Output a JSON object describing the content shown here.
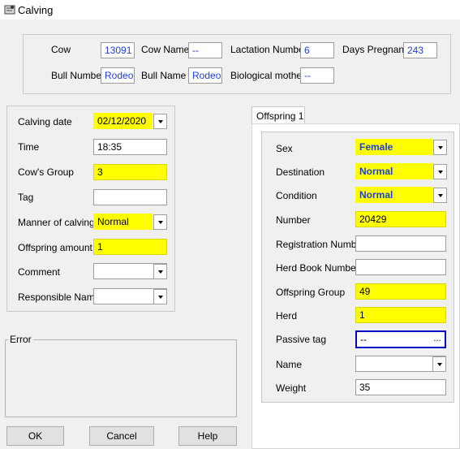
{
  "window": {
    "title": "Calving",
    "icon": "calving-app-icon"
  },
  "header": {
    "cow_label": "Cow",
    "cow_value": "13091",
    "cow_name_label": "Cow Name",
    "cow_name_value": "--",
    "lactation_label": "Lactation Number",
    "lactation_value": "6",
    "days_pregnant_label": "Days Pregnant",
    "days_pregnant_value": "243",
    "bull_number_label": "Bull Number",
    "bull_number_value": "Rodeo",
    "bull_name_label": "Bull Name",
    "bull_name_value": "Rodeo",
    "bio_mother_label": "Biological mother",
    "bio_mother_value": "--"
  },
  "calving": {
    "date_label": "Calving date",
    "date_value": "02/12/2020",
    "time_label": "Time",
    "time_value": "18:35",
    "group_label": "Cow's Group",
    "group_value": "3",
    "tag_label": "Tag",
    "tag_value": "",
    "manner_label": "Manner of calving",
    "manner_value": "Normal",
    "offspring_amount_label": "Offspring amount",
    "offspring_amount_value": "1",
    "comment_label": "Comment",
    "comment_value": "",
    "responsible_label": "Responsible Name",
    "responsible_value": ""
  },
  "error": {
    "legend": "Error"
  },
  "offspring": {
    "tab_label": "Offspring 1",
    "sex_label": "Sex",
    "sex_value": "Female",
    "destination_label": "Destination",
    "destination_value": "Normal",
    "condition_label": "Condition",
    "condition_value": "Normal",
    "number_label": "Number",
    "number_value": "20429",
    "registration_label": "Registration Number",
    "registration_value": "",
    "herd_book_label": "Herd Book Number",
    "herd_book_value": "",
    "group_label": "Offspring Group",
    "group_value": "49",
    "herd_label": "Herd",
    "herd_value": "1",
    "passive_tag_label": "Passive tag",
    "passive_tag_value": "--",
    "passive_tag_button": "...",
    "name_label": "Name",
    "name_value": "",
    "weight_label": "Weight",
    "weight_value": "35"
  },
  "buttons": {
    "ok": "OK",
    "cancel": "Cancel",
    "help": "Help"
  },
  "colors": {
    "highlight": "#ffff00",
    "value_text": "#1f3fd1",
    "focus_border": "#0000c8"
  }
}
